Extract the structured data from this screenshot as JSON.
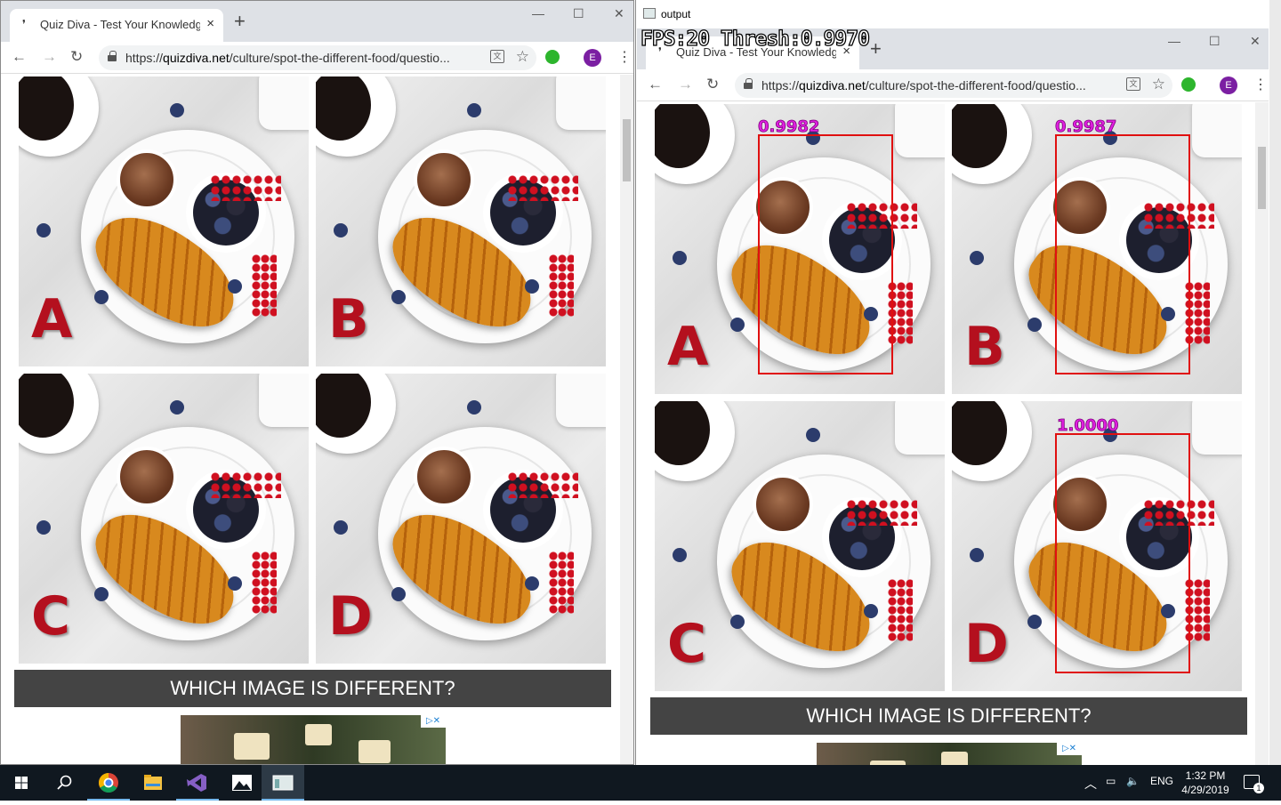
{
  "left_window": {
    "tab_title": "Quiz Diva - Test Your Knowledge",
    "tab_close": "×",
    "new_tab": "+",
    "url_prefix": "https://",
    "url_domain": "quizdiva.net",
    "url_path": "/culture/spot-the-different-food/questio...",
    "profile_initial": "E",
    "caption": "WHICH IMAGE IS DIFFERENT?",
    "images": [
      "A",
      "B",
      "C",
      "D"
    ]
  },
  "output_window": {
    "title": "output",
    "overlay": "FPS:20  Thresh:0.9970",
    "tab_title": "Quiz Diva - Test Your Knowledge",
    "tab_close": "×",
    "new_tab": "+",
    "url_prefix": "https://",
    "url_domain": "quizdiva.net",
    "url_path": "/culture/spot-the-different-food/questio...",
    "profile_initial": "E",
    "caption": "WHICH IMAGE IS DIFFERENT?",
    "images": [
      "A",
      "B",
      "C",
      "D"
    ],
    "detections": [
      {
        "image": "A",
        "score": "0.9982"
      },
      {
        "image": "B",
        "score": "0.9987"
      },
      {
        "image": "D",
        "score": "1.0000"
      }
    ]
  },
  "taskbar": {
    "language": "ENG",
    "time": "1:32 PM",
    "date": "4/29/2019",
    "notification_count": "1"
  },
  "icons": [
    "back-icon",
    "forward-icon",
    "reload-icon",
    "lock-icon",
    "translate-icon",
    "star-icon",
    "extension-icon",
    "menu-icon",
    "windows-start-icon",
    "search-icon",
    "chrome-icon",
    "file-explorer-icon",
    "visual-studio-icon",
    "photos-icon",
    "output-window-icon"
  ],
  "colors": {
    "bbox": "#e01010",
    "score": "#e020e0",
    "caption_bg": "#444444",
    "profile": "#7b1fa2"
  }
}
